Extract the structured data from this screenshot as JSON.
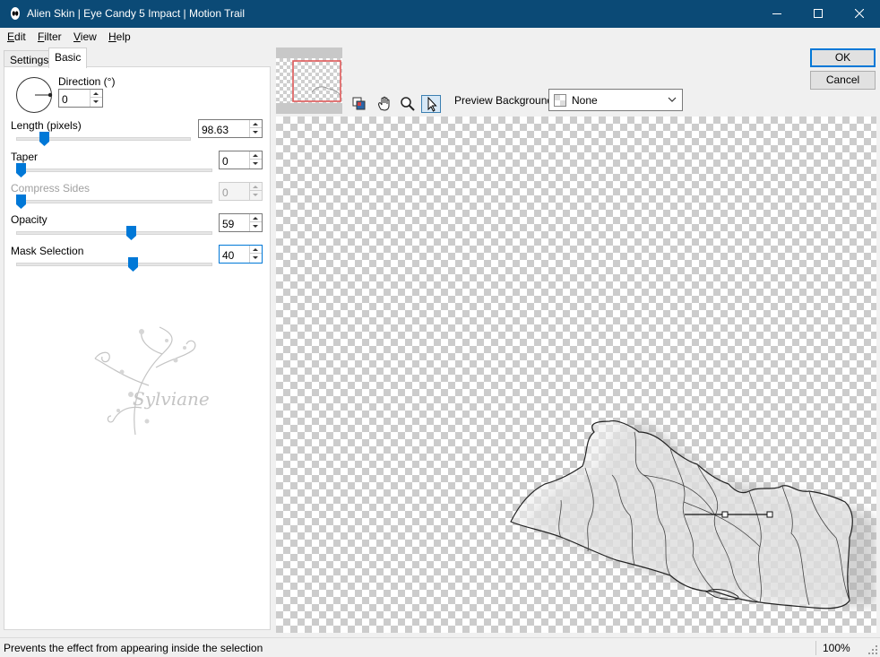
{
  "window": {
    "title": "Alien Skin | Eye Candy 5 Impact | Motion Trail"
  },
  "menu": {
    "items": [
      {
        "u": "E",
        "rest": "dit"
      },
      {
        "u": "F",
        "rest": "ilter"
      },
      {
        "u": "V",
        "rest": "iew"
      },
      {
        "u": "H",
        "rest": "elp"
      }
    ]
  },
  "tabs": {
    "settings": "Settings",
    "basic": "Basic"
  },
  "controls": {
    "direction": {
      "label": "Direction (°)",
      "value": "0"
    },
    "length": {
      "label": "Length (pixels)",
      "value": "98.63",
      "level": 0.14
    },
    "taper": {
      "label": "Taper",
      "value": "0",
      "level": 0.0
    },
    "compress_sides": {
      "label": "Compress Sides",
      "value": "0",
      "level": 0.0
    },
    "opacity": {
      "label": "Opacity",
      "value": "59",
      "level": 0.59
    },
    "mask_selection": {
      "label": "Mask Selection",
      "value": "40",
      "level": 0.6
    }
  },
  "watermark": {
    "text": "Sylviane"
  },
  "preview": {
    "background_label": "Preview Background:",
    "background_value": "None"
  },
  "buttons": {
    "ok": "OK",
    "cancel": "Cancel"
  },
  "status": {
    "text": "Prevents the effect from appearing inside the selection",
    "zoom": "100%"
  },
  "colors": {
    "titlebar": "#0b4a76",
    "accent": "#0078d7",
    "slider_thumb": "#0078d7",
    "preview_frame": "#e05a5a"
  }
}
